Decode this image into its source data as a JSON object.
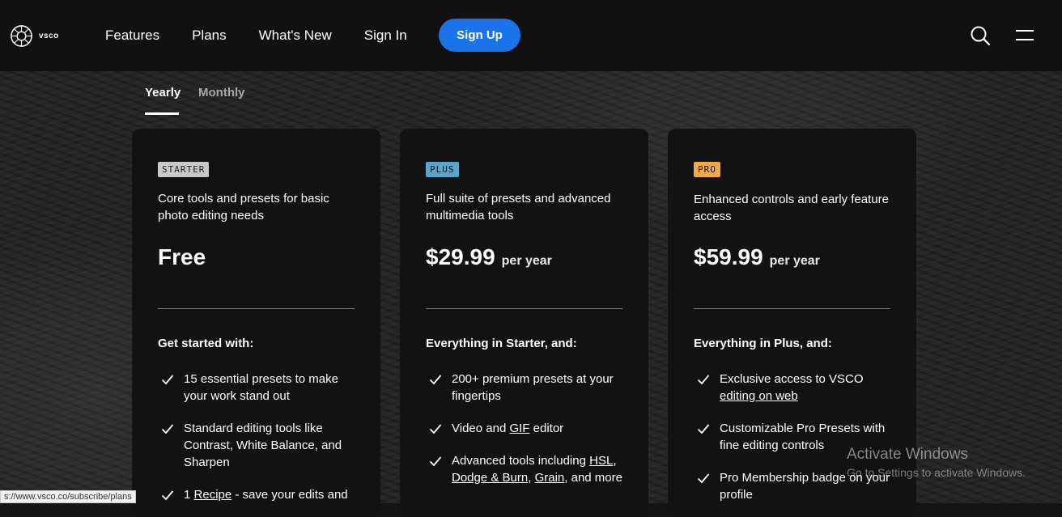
{
  "header": {
    "logo_text": "vsco",
    "nav": [
      "Features",
      "Plans",
      "What's New",
      "Sign In"
    ],
    "signup_label": "Sign Up",
    "search_icon": "search-icon",
    "menu_icon": "hamburger-menu-icon",
    "accent_color": "#1a73e8"
  },
  "tabs": {
    "yearly": "Yearly",
    "monthly": "Monthly",
    "selected": "Yearly"
  },
  "plans": [
    {
      "badge": "STARTER",
      "badge_color": "#c9c9c9",
      "description": "Core tools and presets for basic photo editing needs",
      "price": "Free",
      "period": "",
      "list_title": "Get started with:",
      "features": [
        {
          "text": "15 essential presets to make your work stand out"
        },
        {
          "text": "Standard editing tools like Contrast, White Balance, and Sharpen"
        },
        {
          "pre": "1 ",
          "link": "Recipe",
          "post": " - save your edits and"
        }
      ]
    },
    {
      "badge": "PLUS",
      "badge_color": "#5aa5c9",
      "description": "Full suite of presets and advanced multimedia tools",
      "price": "$29.99",
      "period": "per year",
      "list_title": "Everything in Starter, and:",
      "features": [
        {
          "text": "200+ premium presets at your fingertips"
        },
        {
          "pre": "Video and ",
          "link": "GIF",
          "post": " editor"
        },
        {
          "pre": "Advanced tools including ",
          "link1": "HSL",
          "sep1": ", ",
          "link2": "Dodge & Burn",
          "sep2": ", ",
          "link3": "Grain",
          "post": ", and more"
        }
      ]
    },
    {
      "badge": "PRO",
      "badge_color": "#f3a846",
      "description": "Enhanced controls and early feature access",
      "price": "$59.99",
      "period": "per year",
      "list_title": "Everything in Plus, and:",
      "features": [
        {
          "pre": "Exclusive access to VSCO ",
          "link": "editing on web"
        },
        {
          "text": "Customizable Pro Presets with fine editing controls"
        },
        {
          "text": "Pro Membership badge on your profile"
        }
      ]
    }
  ],
  "status_url": "s://www.vsco.co/subscribe/plans",
  "watermark": {
    "title": "Activate Windows",
    "subtitle": "Go to Settings to activate Windows."
  }
}
